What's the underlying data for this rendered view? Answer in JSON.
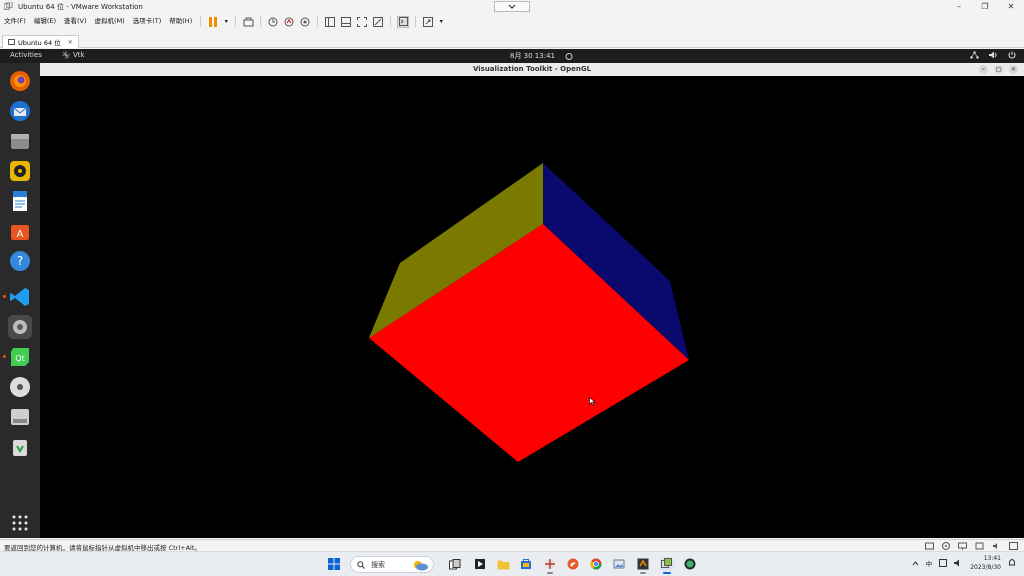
{
  "vmware": {
    "title": "Ubuntu 64 位 - VMware Workstation",
    "menu": [
      "文件(F)",
      "编辑(E)",
      "查看(V)",
      "虚拟机(M)",
      "选项卡(T)",
      "帮助(H)"
    ],
    "tab_label": "Ubuntu 64 位",
    "status_message": "要返回到您的计算机，请将鼠标指针从虚拟机中移出或按 Ctrl+Alt。"
  },
  "ubuntu": {
    "activities": "Activities",
    "app_name": "Vtk",
    "clock": "8月 30  13:41"
  },
  "vtk": {
    "window_title": "Visualization Toolkit - OpenGL",
    "cube_colors": {
      "front": "#ff0000",
      "left": "#7a7a00",
      "right": "#0a0a6e"
    }
  },
  "taskbar": {
    "search_placeholder": "搜索",
    "time": "13:41",
    "date": "2023/8/30",
    "lang": "中"
  },
  "colors": {
    "ubuntu_orange": "#e95420",
    "vmware_orange": "#f08c00"
  }
}
